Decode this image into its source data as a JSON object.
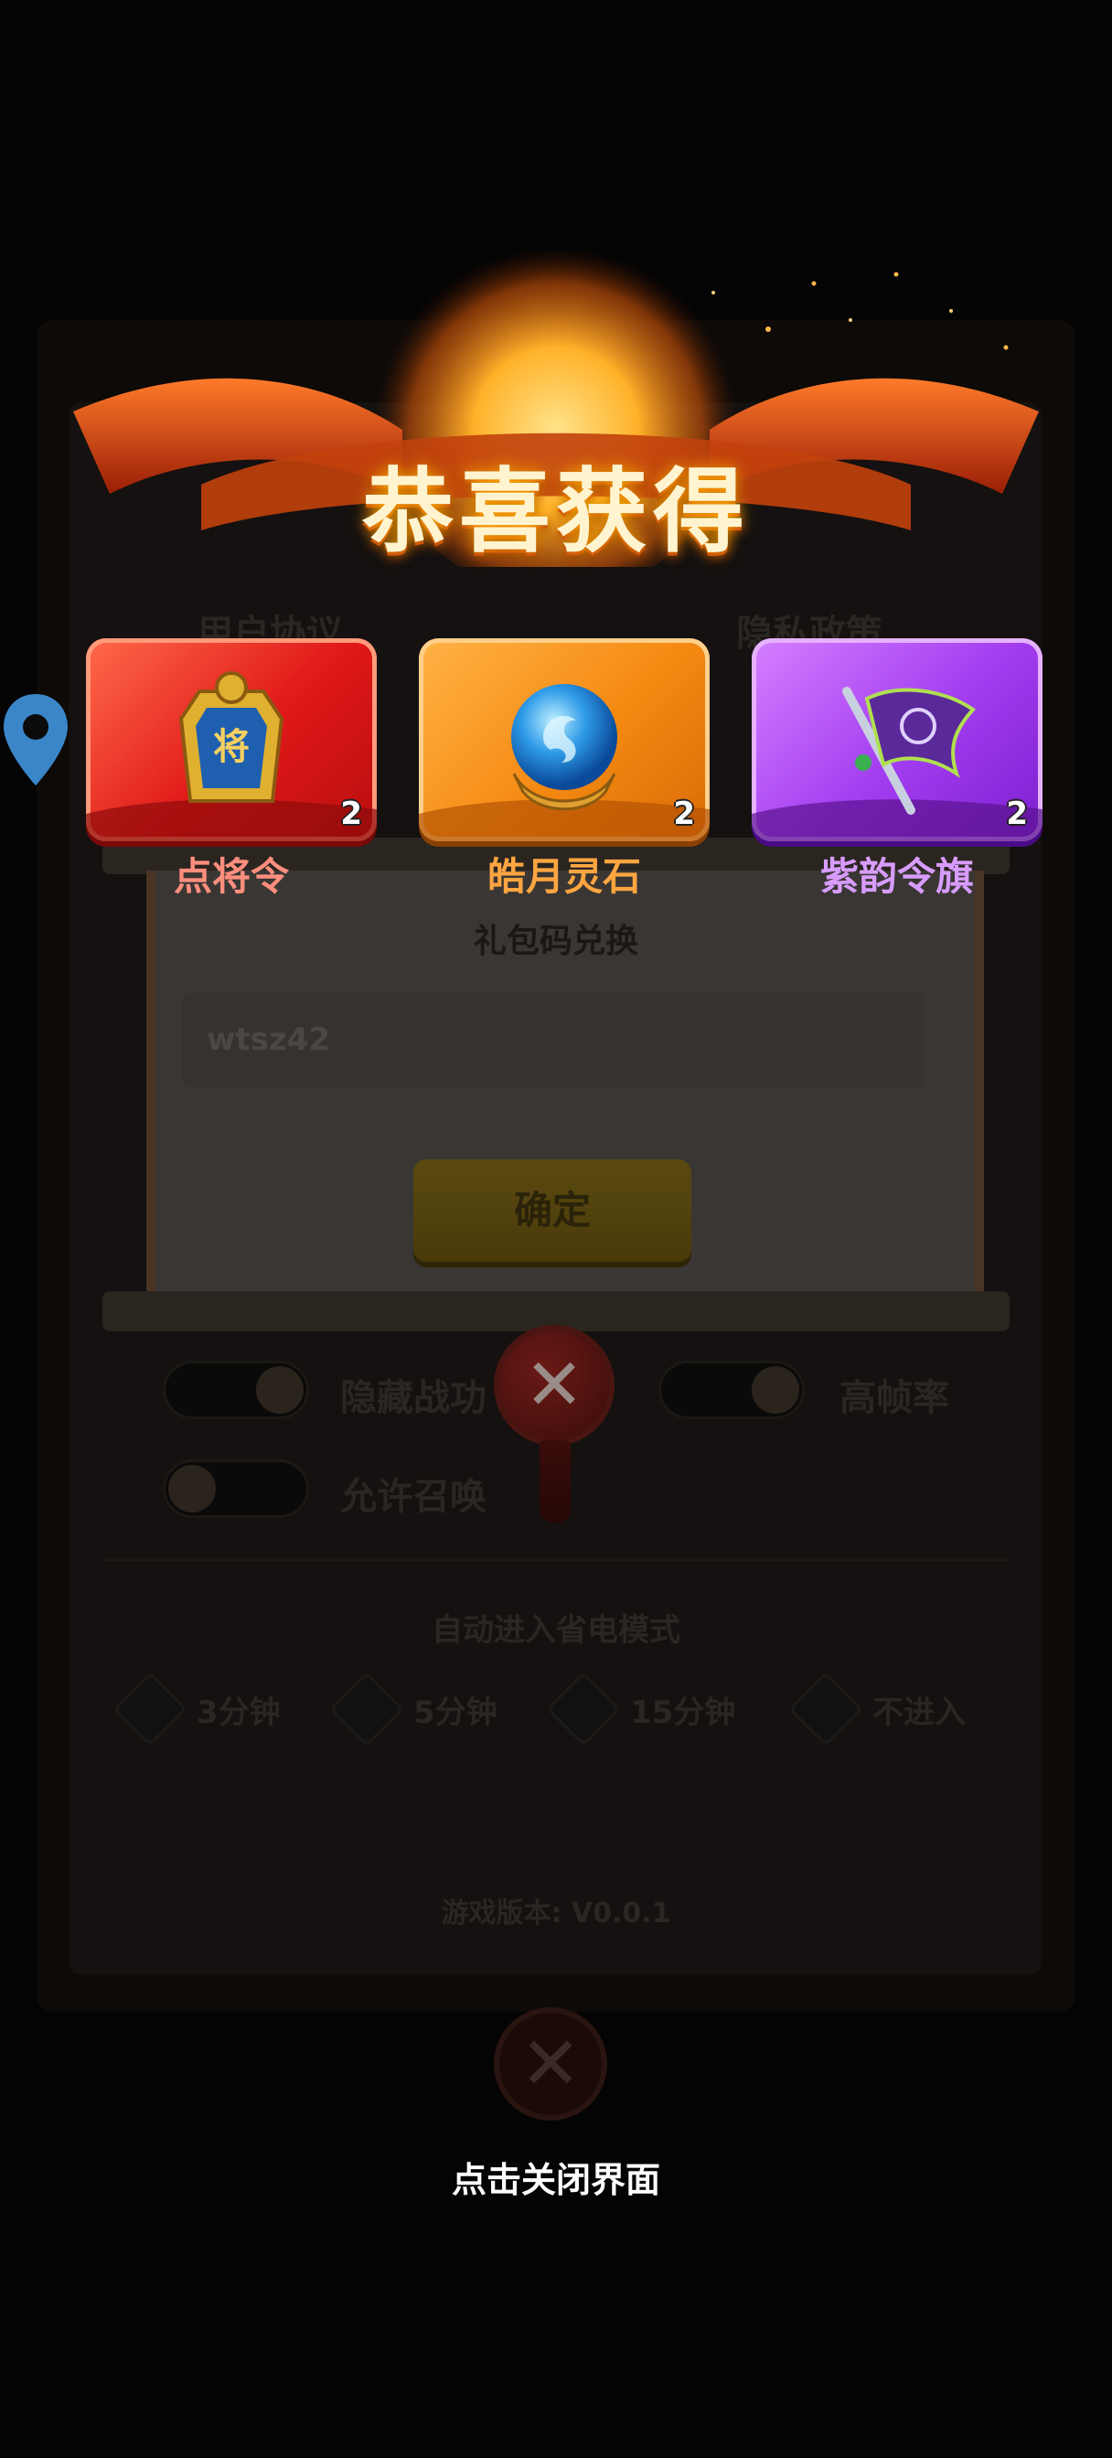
{
  "reward_popup": {
    "title": "恭喜获得",
    "items": [
      {
        "name": "点将令",
        "count": "2",
        "icon": "token-seal-icon",
        "color": "#e01818"
      },
      {
        "name": "皓月灵石",
        "count": "2",
        "icon": "blue-orb-icon",
        "color": "#f58a12"
      },
      {
        "name": "紫韵令旗",
        "count": "2",
        "icon": "purple-flag-icon",
        "color": "#a23cf0"
      }
    ],
    "close_hint": "点击关闭界面"
  },
  "background_panel": {
    "header_left": "用户协议",
    "header_right": "隐私政策",
    "gift_code": {
      "title": "礼包码兑换",
      "input_value": "wtsz42",
      "confirm_label": "确定"
    },
    "toggles": [
      {
        "label": "隐藏战功",
        "on": true
      },
      {
        "label": "高帧率",
        "on": true
      },
      {
        "label": "允许召唤",
        "on": false
      }
    ],
    "power_saving": {
      "title": "自动进入省电模式",
      "options": [
        "3分钟",
        "5分钟",
        "15分钟",
        "不进入"
      ],
      "selected": "3分钟"
    },
    "version": "游戏版本: V0.0.1"
  }
}
